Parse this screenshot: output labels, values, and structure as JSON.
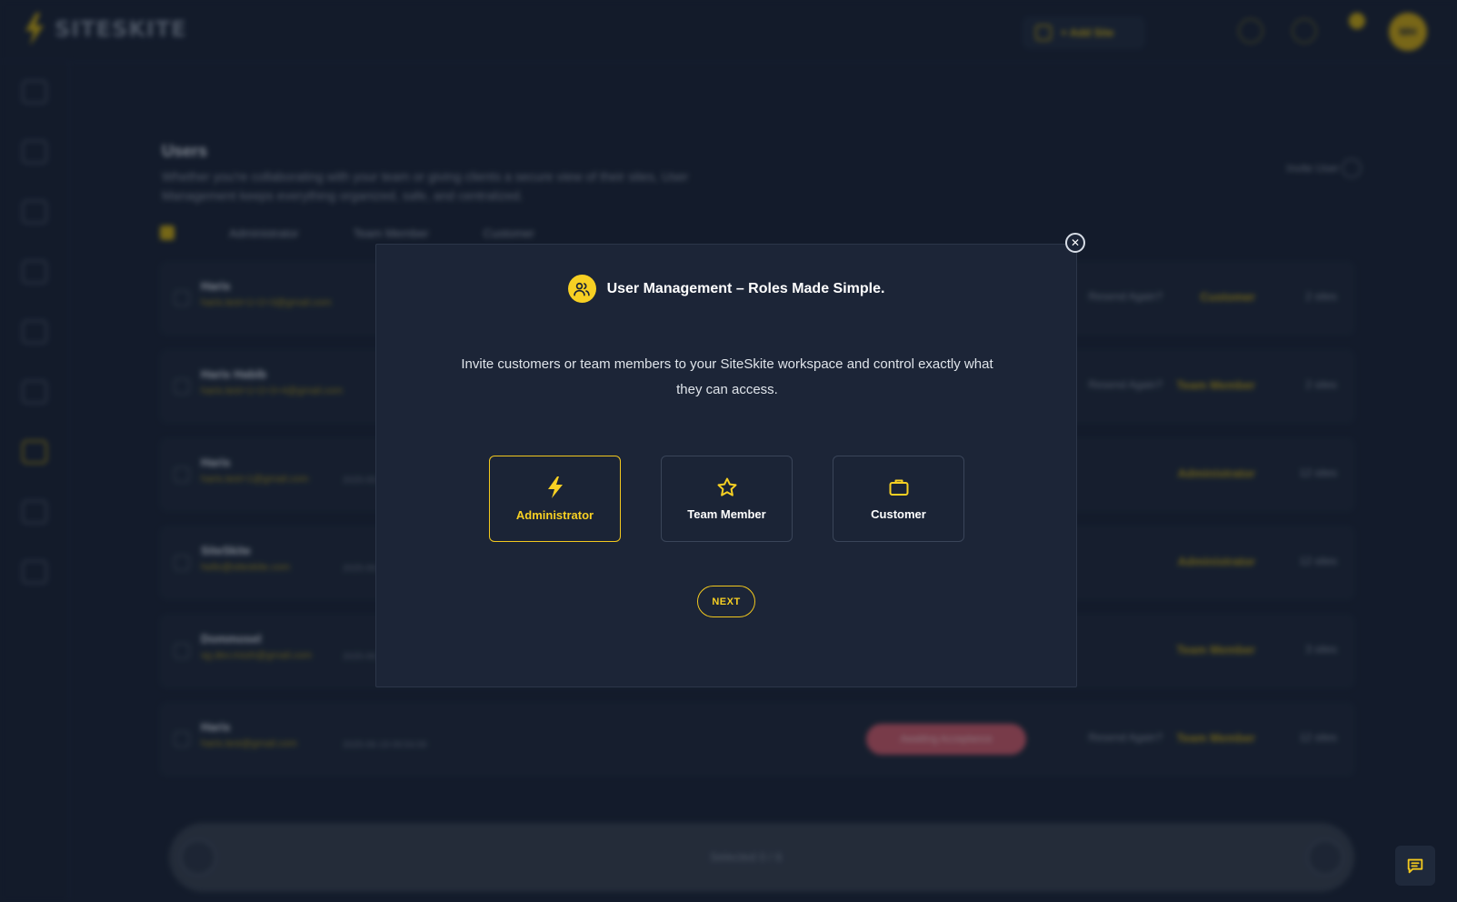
{
  "header": {
    "logo_text": "SITESKITE",
    "add_site_label": "+ Add Site",
    "avatar_initials": "MH"
  },
  "page": {
    "heading": "Users",
    "description": "Whether you're collaborating with your team or giving clients a secure view of their sites, User Management keeps everything organized, safe, and centralized.",
    "invite_label": "Invite User"
  },
  "tabs": [
    "Administrator",
    "Team Member",
    "Customer"
  ],
  "users": [
    {
      "name": "Haris",
      "email": "haris.test+1+2+3@gmail.com",
      "date": "",
      "resend": "Resend Again?",
      "role": "Customer",
      "sites": "2 sites",
      "pill": ""
    },
    {
      "name": "Haris Habib",
      "email": "haris.test+1+2+3+4@gmail.com",
      "date": "",
      "resend": "Resend Again?",
      "role": "Team Member",
      "sites": "2 sites",
      "pill": ""
    },
    {
      "name": "Haris",
      "email": "haris.test+1@gmail.com",
      "date": "2025-05-12",
      "resend": "",
      "role": "Administrator",
      "sites": "12 sites",
      "pill": ""
    },
    {
      "name": "SiteSkite",
      "email": "hello@siteskite.com",
      "date": "2025-06-18",
      "resend": "",
      "role": "Administrator",
      "sites": "12 sites",
      "pill": ""
    },
    {
      "name": "Dommosel",
      "email": "sg.dev.mssh@gmail.com",
      "date": "2025-06-20",
      "resend": "",
      "role": "Team Member",
      "sites": "3 sites",
      "pill": ""
    },
    {
      "name": "Haris",
      "email": "haris.test@gmail.com",
      "date": "2025-06-19 09:54:00",
      "resend": "Resend Again?",
      "role": "Team Member",
      "sites": "12 sites",
      "pill": "Awaiting Acceptance"
    }
  ],
  "bottom_bar": {
    "text": "Selected 0 / 6"
  },
  "modal": {
    "title": "User Management – Roles Made Simple.",
    "description": "Invite customers or team members to your SiteSkite workspace and control exactly what they can access.",
    "roles": [
      {
        "label": "Administrator",
        "icon": "lightning-icon",
        "selected": true
      },
      {
        "label": "Team Member",
        "icon": "star-icon",
        "selected": false
      },
      {
        "label": "Customer",
        "icon": "briefcase-icon",
        "selected": false
      }
    ],
    "next_label": "NEXT",
    "close_symbol": "✕"
  },
  "colors": {
    "accent": "#f7d023",
    "background": "#1b2436",
    "modal_bg": "#1c2537"
  }
}
